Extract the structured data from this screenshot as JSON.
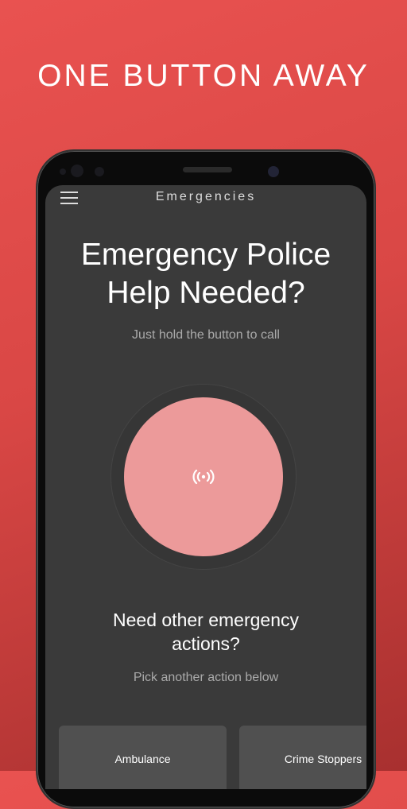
{
  "headline": "ONE BUTTON AWAY",
  "app": {
    "title": "Emergencies",
    "heading_line1": "Emergency Police",
    "heading_line2": "Help Needed?",
    "hint": "Just hold the button to call",
    "other_line1": "Need other emergency",
    "other_line2": "actions?",
    "other_hint": "Pick another action below",
    "actions": [
      {
        "label": "Ambulance"
      },
      {
        "label": "Crime Stoppers"
      }
    ]
  },
  "colors": {
    "background": "#e14c4a",
    "button": "#ec9a9a",
    "screen": "#3a3a3a"
  }
}
